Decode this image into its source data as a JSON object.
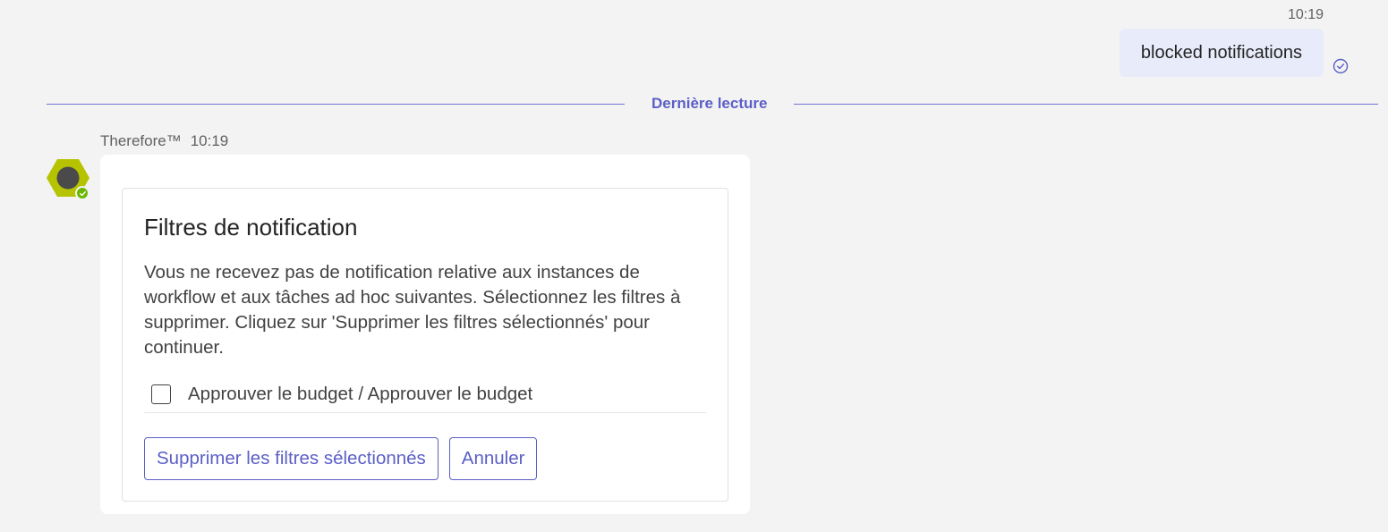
{
  "outgoing": {
    "time": "10:19",
    "text": "blocked notifications",
    "read_icon": "check-circle-icon"
  },
  "divider": {
    "label": "Dernière lecture"
  },
  "incoming": {
    "sender": "Therefore™",
    "time": "10:19",
    "avatar_icon": "therefore-hexagon-logo",
    "presence": "available",
    "colors": {
      "avatar_hex": "#b5c300",
      "presence": "#6bb700"
    }
  },
  "card": {
    "title": "Filtres de notification",
    "body": "Vous ne recevez pas de notification relative aux instances de workflow et aux tâches ad hoc suivantes. Sélectionnez les filtres à supprimer. Cliquez sur 'Supprimer les filtres sélectionnés' pour continuer.",
    "filters": [
      {
        "label": "Approuver le budget / Approuver le budget",
        "checked": false
      }
    ],
    "buttons": {
      "remove_label": "Supprimer les filtres sélectionnés",
      "cancel_label": "Annuler"
    }
  },
  "colors": {
    "accent": "#5b5fc7",
    "background": "#f3f3f3",
    "outgoing_bubble": "#e8ebfa"
  }
}
